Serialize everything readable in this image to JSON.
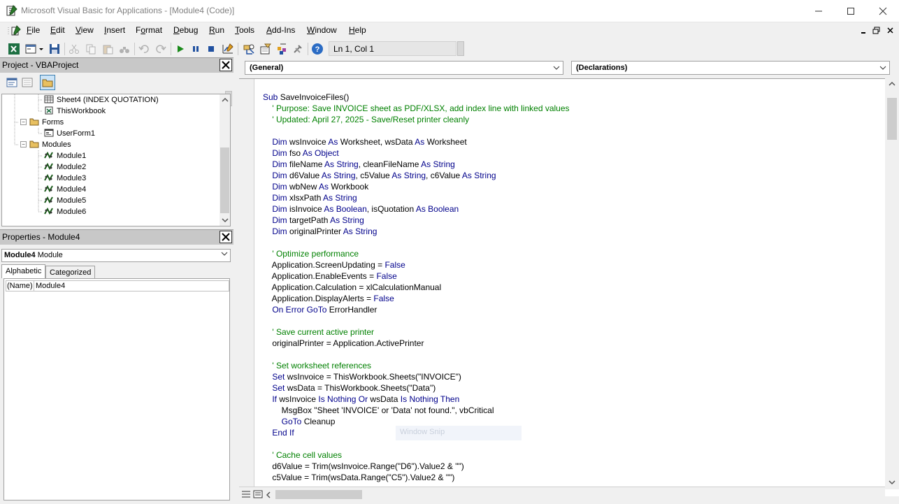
{
  "window": {
    "title": "Microsoft Visual Basic for Applications - [Module4 (Code)]",
    "minimize": "—",
    "maximize": "☐",
    "close": "✕"
  },
  "menu": {
    "items": [
      {
        "key": "F",
        "rest": "ile"
      },
      {
        "key": "E",
        "rest": "dit"
      },
      {
        "key": "V",
        "rest": "iew"
      },
      {
        "key": "I",
        "rest": "nsert"
      },
      {
        "key": "F",
        "rest": "ormat",
        "pre": "F",
        "alt": "Format"
      },
      {
        "key": "D",
        "rest": "ebug"
      },
      {
        "key": "R",
        "rest": "un"
      },
      {
        "key": "T",
        "rest": "ools"
      },
      {
        "key": "A",
        "rest": "dd-Ins"
      },
      {
        "key": "W",
        "rest": "indow"
      },
      {
        "key": "H",
        "rest": "elp"
      }
    ],
    "mdi_minimize": "_",
    "mdi_restore": "🗗",
    "mdi_close": "✕"
  },
  "toolbar": {
    "position": "Ln 1, Col 1"
  },
  "project": {
    "title": "Project - VBAProject",
    "close": "✕",
    "tree": [
      {
        "label": "Sheet4 (INDEX QUOTATION)",
        "type": "sheet"
      },
      {
        "label": "ThisWorkbook",
        "type": "workbook"
      },
      {
        "label": "Forms",
        "type": "folder"
      },
      {
        "label": "UserForm1",
        "type": "form"
      },
      {
        "label": "Modules",
        "type": "folder"
      },
      {
        "label": "Module1",
        "type": "module"
      },
      {
        "label": "Module2",
        "type": "module"
      },
      {
        "label": "Module3",
        "type": "module"
      },
      {
        "label": "Module4",
        "type": "module"
      },
      {
        "label": "Module5",
        "type": "module"
      },
      {
        "label": "Module6",
        "type": "module"
      }
    ]
  },
  "properties": {
    "title": "Properties - Module4",
    "close": "✕",
    "object_name": "Module4",
    "object_type": "Module",
    "tabs": [
      "Alphabetic",
      "Categorized"
    ],
    "rows": [
      {
        "name": "(Name)",
        "value": "Module4"
      }
    ]
  },
  "code": {
    "object_combo": "(General)",
    "procedure_combo": "(Declarations)",
    "lines": [
      [
        [
          "kw",
          "Sub "
        ],
        [
          "tx",
          "SaveInvoiceFiles()"
        ]
      ],
      [
        [
          "tx",
          "    "
        ],
        [
          "cm",
          "' Purpose: Save INVOICE sheet as PDF/XLSX, add index line with linked values"
        ]
      ],
      [
        [
          "tx",
          "    "
        ],
        [
          "cm",
          "' Updated: April 27, 2025 - Save/Reset printer cleanly"
        ]
      ],
      [
        [
          "tx",
          ""
        ]
      ],
      [
        [
          "tx",
          "    "
        ],
        [
          "kw",
          "Dim "
        ],
        [
          "tx",
          "wsInvoice "
        ],
        [
          "kw",
          "As "
        ],
        [
          "tx",
          "Worksheet, wsData "
        ],
        [
          "kw",
          "As "
        ],
        [
          "tx",
          "Worksheet"
        ]
      ],
      [
        [
          "tx",
          "    "
        ],
        [
          "kw",
          "Dim "
        ],
        [
          "tx",
          "fso "
        ],
        [
          "kw",
          "As Object"
        ]
      ],
      [
        [
          "tx",
          "    "
        ],
        [
          "kw",
          "Dim "
        ],
        [
          "tx",
          "fileName "
        ],
        [
          "kw",
          "As String"
        ],
        [
          "tx",
          ", cleanFileName "
        ],
        [
          "kw",
          "As String"
        ]
      ],
      [
        [
          "tx",
          "    "
        ],
        [
          "kw",
          "Dim "
        ],
        [
          "tx",
          "d6Value "
        ],
        [
          "kw",
          "As String"
        ],
        [
          "tx",
          ", c5Value "
        ],
        [
          "kw",
          "As String"
        ],
        [
          "tx",
          ", c6Value "
        ],
        [
          "kw",
          "As String"
        ]
      ],
      [
        [
          "tx",
          "    "
        ],
        [
          "kw",
          "Dim "
        ],
        [
          "tx",
          "wbNew "
        ],
        [
          "kw",
          "As "
        ],
        [
          "tx",
          "Workbook"
        ]
      ],
      [
        [
          "tx",
          "    "
        ],
        [
          "kw",
          "Dim "
        ],
        [
          "tx",
          "xlsxPath "
        ],
        [
          "kw",
          "As String"
        ]
      ],
      [
        [
          "tx",
          "    "
        ],
        [
          "kw",
          "Dim "
        ],
        [
          "tx",
          "isInvoice "
        ],
        [
          "kw",
          "As Boolean"
        ],
        [
          "tx",
          ", isQuotation "
        ],
        [
          "kw",
          "As Boolean"
        ]
      ],
      [
        [
          "tx",
          "    "
        ],
        [
          "kw",
          "Dim "
        ],
        [
          "tx",
          "targetPath "
        ],
        [
          "kw",
          "As String"
        ]
      ],
      [
        [
          "tx",
          "    "
        ],
        [
          "kw",
          "Dim "
        ],
        [
          "tx",
          "originalPrinter "
        ],
        [
          "kw",
          "As String"
        ]
      ],
      [
        [
          "tx",
          ""
        ]
      ],
      [
        [
          "tx",
          "    "
        ],
        [
          "cm",
          "' Optimize performance"
        ]
      ],
      [
        [
          "tx",
          "    Application.ScreenUpdating = "
        ],
        [
          "kw",
          "False"
        ]
      ],
      [
        [
          "tx",
          "    Application.EnableEvents = "
        ],
        [
          "kw",
          "False"
        ]
      ],
      [
        [
          "tx",
          "    Application.Calculation = xlCalculationManual"
        ]
      ],
      [
        [
          "tx",
          "    Application.DisplayAlerts = "
        ],
        [
          "kw",
          "False"
        ]
      ],
      [
        [
          "tx",
          "    "
        ],
        [
          "kw",
          "On Error GoTo "
        ],
        [
          "tx",
          "ErrorHandler"
        ]
      ],
      [
        [
          "tx",
          ""
        ]
      ],
      [
        [
          "tx",
          "    "
        ],
        [
          "cm",
          "' Save current active printer"
        ]
      ],
      [
        [
          "tx",
          "    originalPrinter = Application.ActivePrinter"
        ]
      ],
      [
        [
          "tx",
          ""
        ]
      ],
      [
        [
          "tx",
          "    "
        ],
        [
          "cm",
          "' Set worksheet references"
        ]
      ],
      [
        [
          "tx",
          "    "
        ],
        [
          "kw",
          "Set "
        ],
        [
          "tx",
          "wsInvoice = ThisWorkbook.Sheets(\"INVOICE\")"
        ]
      ],
      [
        [
          "tx",
          "    "
        ],
        [
          "kw",
          "Set "
        ],
        [
          "tx",
          "wsData = ThisWorkbook.Sheets(\"Data\")"
        ]
      ],
      [
        [
          "tx",
          "    "
        ],
        [
          "kw",
          "If "
        ],
        [
          "tx",
          "wsInvoice "
        ],
        [
          "kw",
          "Is Nothing Or "
        ],
        [
          "tx",
          "wsData "
        ],
        [
          "kw",
          "Is Nothing Then"
        ]
      ],
      [
        [
          "tx",
          "        MsgBox \"Sheet 'INVOICE' or 'Data' not found.\", vbCritical"
        ]
      ],
      [
        [
          "tx",
          "        "
        ],
        [
          "kw",
          "GoTo "
        ],
        [
          "tx",
          "Cleanup"
        ]
      ],
      [
        [
          "tx",
          "    "
        ],
        [
          "kw",
          "End If"
        ]
      ],
      [
        [
          "tx",
          ""
        ]
      ],
      [
        [
          "tx",
          "    "
        ],
        [
          "cm",
          "' Cache cell values"
        ]
      ],
      [
        [
          "tx",
          "    d6Value = Trim(wsInvoice.Range(\"D6\").Value2 & \"\")"
        ]
      ],
      [
        [
          "tx",
          "    c5Value = Trim(wsData.Range(\"C5\").Value2 & \"\")"
        ]
      ]
    ]
  },
  "overlay": {
    "snip_label": "Window Snip"
  }
}
